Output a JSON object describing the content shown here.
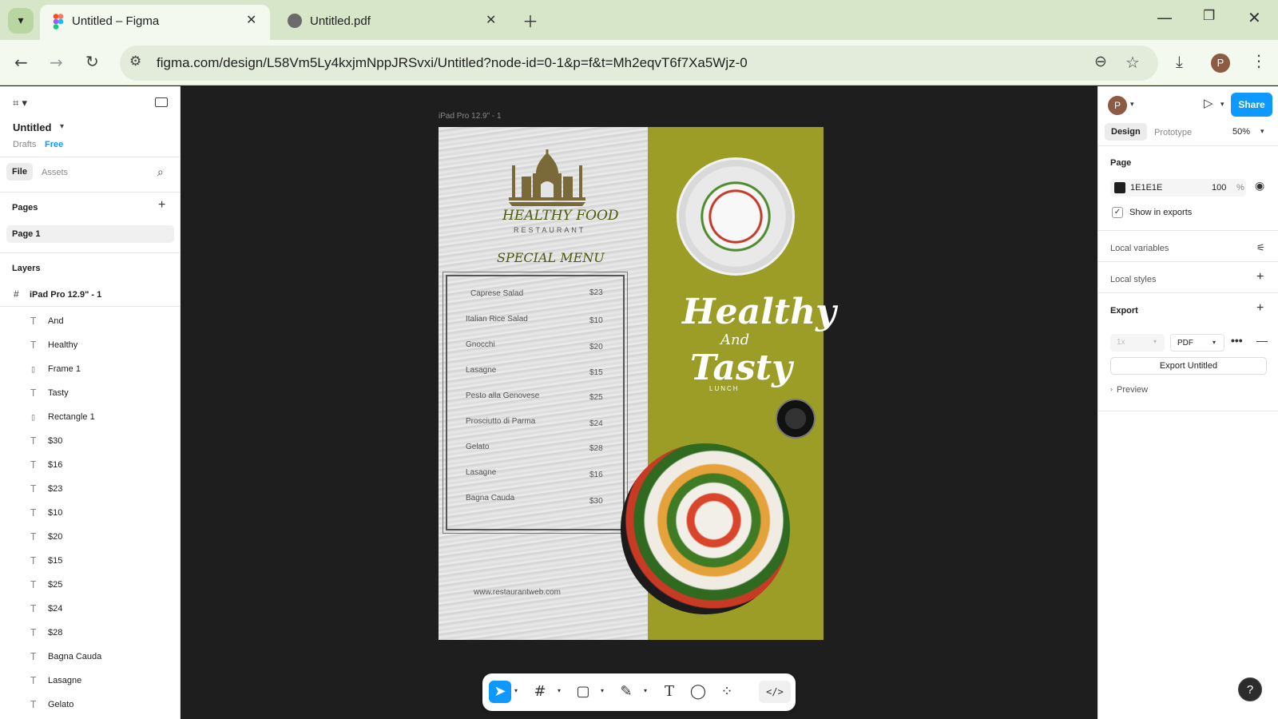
{
  "browser": {
    "tabs": [
      {
        "title": "Untitled – Figma",
        "icon": "figma-icon",
        "active": true
      },
      {
        "title": "Untitled.pdf",
        "icon": "globe-icon",
        "active": false
      }
    ],
    "url": "figma.com/design/L58Vm5Ly4kxjmNppJRSvxi/Untitled?node-id=0-1&p=f&t=Mh2eqvT6f7Xa5Wjz-0",
    "profile_initial": "P"
  },
  "figma_left": {
    "file_name": "Untitled",
    "drafts": "Drafts",
    "plan": "Free",
    "tab_file": "File",
    "tab_assets": "Assets",
    "pages_label": "Pages",
    "current_page": "Page 1",
    "layers_label": "Layers",
    "frame_name": "iPad Pro 12.9\" - 1",
    "layers": [
      {
        "icon": "T",
        "name": "And"
      },
      {
        "icon": "T",
        "name": "Healthy"
      },
      {
        "icon": "▯",
        "name": "Frame 1"
      },
      {
        "icon": "T",
        "name": "Tasty"
      },
      {
        "icon": "▯",
        "name": "Rectangle 1"
      },
      {
        "icon": "T",
        "name": "$30"
      },
      {
        "icon": "T",
        "name": "$16"
      },
      {
        "icon": "T",
        "name": "$23"
      },
      {
        "icon": "T",
        "name": "$10"
      },
      {
        "icon": "T",
        "name": "$20"
      },
      {
        "icon": "T",
        "name": "$15"
      },
      {
        "icon": "T",
        "name": "$25"
      },
      {
        "icon": "T",
        "name": "$24"
      },
      {
        "icon": "T",
        "name": "$28"
      },
      {
        "icon": "T",
        "name": "Bagna Cauda"
      },
      {
        "icon": "T",
        "name": "Lasagne"
      },
      {
        "icon": "T",
        "name": "Gelato"
      }
    ]
  },
  "figma_right": {
    "avatar_initial": "P",
    "share_label": "Share",
    "tab_design": "Design",
    "tab_prototype": "Prototype",
    "zoom": "50%",
    "page_section": "Page",
    "bg_color_hex": "1E1E1E",
    "bg_opacity": "100",
    "percent_sign": "%",
    "show_in_exports": "Show in exports",
    "local_variables": "Local variables",
    "local_styles": "Local styles",
    "export_section": "Export",
    "export_scale": "1x",
    "export_format": "PDF",
    "export_button": "Export Untitled",
    "preview": "Preview"
  },
  "canvas": {
    "frame_label": "iPad Pro 12.9\" - 1",
    "poster": {
      "brand": "HEALTHY FOOD",
      "brand_sub": "RESTAURANT",
      "special_menu": "SPECIAL MENU",
      "menu_items": [
        {
          "name": "Caprese Salad",
          "price": "$23"
        },
        {
          "name": "Italian Rice Salad",
          "price": "$10"
        },
        {
          "name": "Gnocchi",
          "price": "$20"
        },
        {
          "name": "Lasagne",
          "price": "$15"
        },
        {
          "name": "Pesto alla Genovese",
          "price": "$25"
        },
        {
          "name": "Prosciutto di Parma",
          "price": "$24"
        },
        {
          "name": "Gelato",
          "price": "$28"
        },
        {
          "name": "Lasagne",
          "price": "$16"
        },
        {
          "name": "Bagna Cauda",
          "price": "$30"
        }
      ],
      "website": "www.restaurantweb.com",
      "headline_1": "Healthy",
      "headline_and": "And",
      "headline_2": "Tasty",
      "headline_sub": "LUNCH"
    }
  },
  "colors": {
    "accent_blue": "#0d99ff",
    "poster_green": "#9b9d26",
    "canvas_bg": "#1e1e1e"
  }
}
